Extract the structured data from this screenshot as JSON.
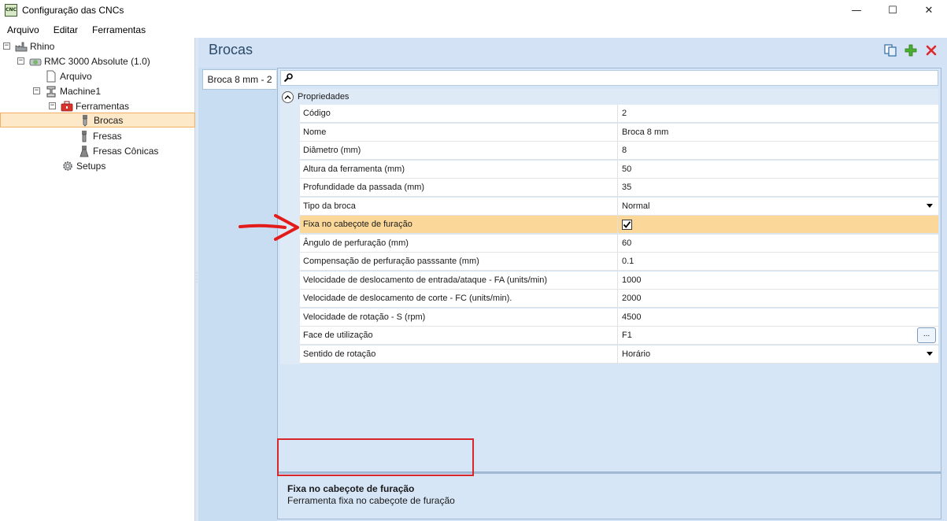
{
  "window": {
    "title": "Configuração das CNCs",
    "icon_text": "CNC",
    "minimize": "—",
    "maximize": "☐",
    "close": "✕"
  },
  "menu": [
    "Arquivo",
    "Editar",
    "Ferramentas"
  ],
  "tree": {
    "root": "Rhino",
    "machine": "RMC 3000 Absolute (1.0)",
    "arquivo": "Arquivo",
    "machine1": "Machine1",
    "ferramentas": "Ferramentas",
    "brocas": "Brocas",
    "fresas": "Fresas",
    "fresas_conicas": "Fresas Cônicas",
    "setups": "Setups"
  },
  "page": {
    "heading": "Brocas",
    "tab": "Broca 8 mm - 2"
  },
  "grid": {
    "category": "Propriedades",
    "rows": [
      {
        "name": "Código",
        "value": "2"
      },
      {
        "name": "Nome",
        "value": "Broca 8 mm"
      },
      {
        "name": "Diâmetro (mm)",
        "value": "8"
      },
      {
        "name": "Altura da ferramenta (mm)",
        "value": "50"
      },
      {
        "name": "Profundidade da passada (mm)",
        "value": "35"
      },
      {
        "name": "Tipo da broca",
        "value": "Normal"
      },
      {
        "name": "Fixa no cabeçote de furação",
        "value": "✔"
      },
      {
        "name": "Ângulo de perfuração (mm)",
        "value": "60"
      },
      {
        "name": "Compensação de perfuração passsante (mm)",
        "value": "0.1"
      },
      {
        "name": "Velocidade de deslocamento de entrada/ataque - FA (units/min)",
        "value": "1000"
      },
      {
        "name": "Velocidade de deslocamento de corte - FC (units/min).",
        "value": "2000"
      },
      {
        "name": "Velocidade de rotação - S (rpm)",
        "value": "4500"
      },
      {
        "name": "Face de utilização",
        "value": "F1"
      },
      {
        "name": "Sentido de rotação",
        "value": "Horário"
      }
    ],
    "ellipsis": "..."
  },
  "description": {
    "title": "Fixa no cabeçote de furação",
    "text": "Ferramenta fixa no cabeçote de furação"
  }
}
